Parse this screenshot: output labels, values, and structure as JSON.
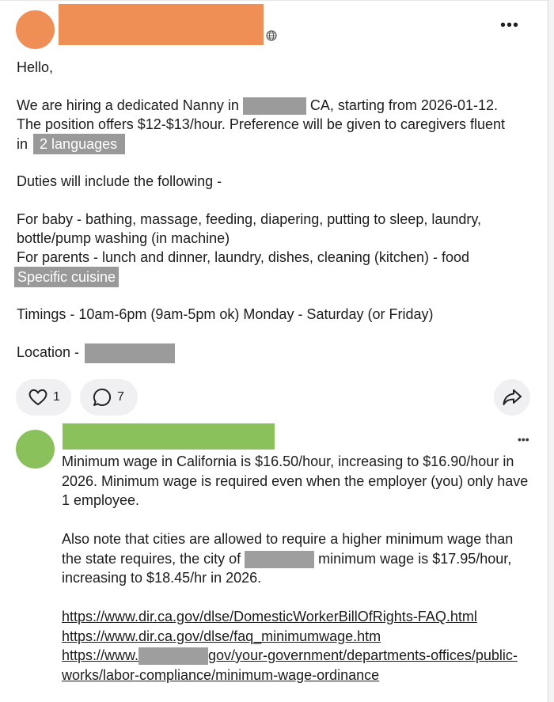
{
  "post": {
    "greeting": "Hello,",
    "line1_a": "We are hiring a dedicated Nanny in",
    "line1_b": "CA, starting from 2026-01-12.",
    "line2": "The position offers $12-$13/hour. Preference will be given to caregivers fluent",
    "line3_prefix": "in",
    "languages_tag": "2 languages",
    "duties_intro": "Duties will include the following -",
    "baby_line1": "For baby - bathing, massage, feeding, diapering, putting to sleep, laundry,",
    "baby_line2": "bottle/pump washing (in machine)",
    "parents_line": "For parents - lunch and dinner, laundry, dishes, cleaning (kitchen) - food",
    "cuisine_tag": "Specific cuisine",
    "timings": "Timings - 10am-6pm (9am-5pm ok) Monday - Saturday (or Friday)",
    "location_label": "Location -"
  },
  "actions": {
    "like_count": "1",
    "comment_count": "7"
  },
  "comment": {
    "p1": "Minimum wage in California is $16.50/hour, increasing to $16.90/hour in 2026. Minimum wage is required even when the employer (you) only have 1 employee.",
    "p2_a": "Also note that cities are allowed to require a higher minimum wage than the state requires, the city of",
    "p2_b": "minimum wage is $17.95/hour, increasing to $18.45/hr in 2026.",
    "link1": "https://www.dir.ca.gov/dlse/DomesticWorkerBillOfRights-FAQ.html",
    "link2": "https://www.dir.ca.gov/dlse/faq_minimumwage.htm",
    "link3_a": "https://www.",
    "link3_b": "gov/your-government/departments-offices/public-works/labor-compliance/minimum-wage-ordinance"
  },
  "colors": {
    "post_avatar": "#f08f55",
    "comment_avatar": "#8bc15a",
    "redaction": "#9b9b9b"
  },
  "icons": [
    "globe-icon",
    "more-icon",
    "heart-icon",
    "comment-icon",
    "share-icon"
  ]
}
